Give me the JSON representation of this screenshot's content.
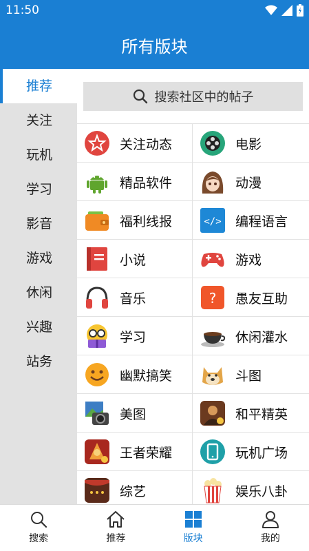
{
  "status": {
    "time": "11:50"
  },
  "header": {
    "title": "所有版块"
  },
  "sidebar": {
    "items": [
      {
        "label": "推荐",
        "active": true
      },
      {
        "label": "关注",
        "active": false
      },
      {
        "label": "玩机",
        "active": false
      },
      {
        "label": "学习",
        "active": false
      },
      {
        "label": "影音",
        "active": false
      },
      {
        "label": "游戏",
        "active": false
      },
      {
        "label": "休闲",
        "active": false
      },
      {
        "label": "兴趣",
        "active": false
      },
      {
        "label": "站务",
        "active": false
      }
    ]
  },
  "search": {
    "placeholder": "搜索社区中的帖子"
  },
  "boards": [
    {
      "label": "关注动态",
      "icon": "star-badge-icon"
    },
    {
      "label": "电影",
      "icon": "film-reel-icon"
    },
    {
      "label": "精品软件",
      "icon": "android-icon"
    },
    {
      "label": "动漫",
      "icon": "anime-girl-icon"
    },
    {
      "label": "福利线报",
      "icon": "wallet-icon"
    },
    {
      "label": "编程语言",
      "icon": "code-icon"
    },
    {
      "label": "小说",
      "icon": "book-icon"
    },
    {
      "label": "游戏",
      "icon": "gamepad-icon"
    },
    {
      "label": "音乐",
      "icon": "headphones-icon"
    },
    {
      "label": "愚友互助",
      "icon": "question-icon"
    },
    {
      "label": "学习",
      "icon": "nerd-emoji-icon"
    },
    {
      "label": "休闲灌水",
      "icon": "coffee-cup-icon"
    },
    {
      "label": "幽默搞笑",
      "icon": "smile-emoji-icon"
    },
    {
      "label": "斗图",
      "icon": "doge-icon"
    },
    {
      "label": "美图",
      "icon": "camera-photo-icon"
    },
    {
      "label": "和平精英",
      "icon": "pubg-game-icon"
    },
    {
      "label": "王者荣耀",
      "icon": "hok-game-icon"
    },
    {
      "label": "玩机广场",
      "icon": "phone-icon"
    },
    {
      "label": "综艺",
      "icon": "stage-icon"
    },
    {
      "label": "娱乐八卦",
      "icon": "popcorn-icon"
    }
  ],
  "bottom_nav": {
    "items": [
      {
        "label": "搜索",
        "icon": "search-icon",
        "active": false
      },
      {
        "label": "推荐",
        "icon": "home-icon",
        "active": false
      },
      {
        "label": "版块",
        "icon": "grid-icon",
        "active": true
      },
      {
        "label": "我的",
        "icon": "person-icon",
        "active": false
      }
    ]
  },
  "colors": {
    "accent": "#1a7fd3",
    "sidebar_bg": "#e2e2e2",
    "search_bg": "#e0e0e0"
  }
}
